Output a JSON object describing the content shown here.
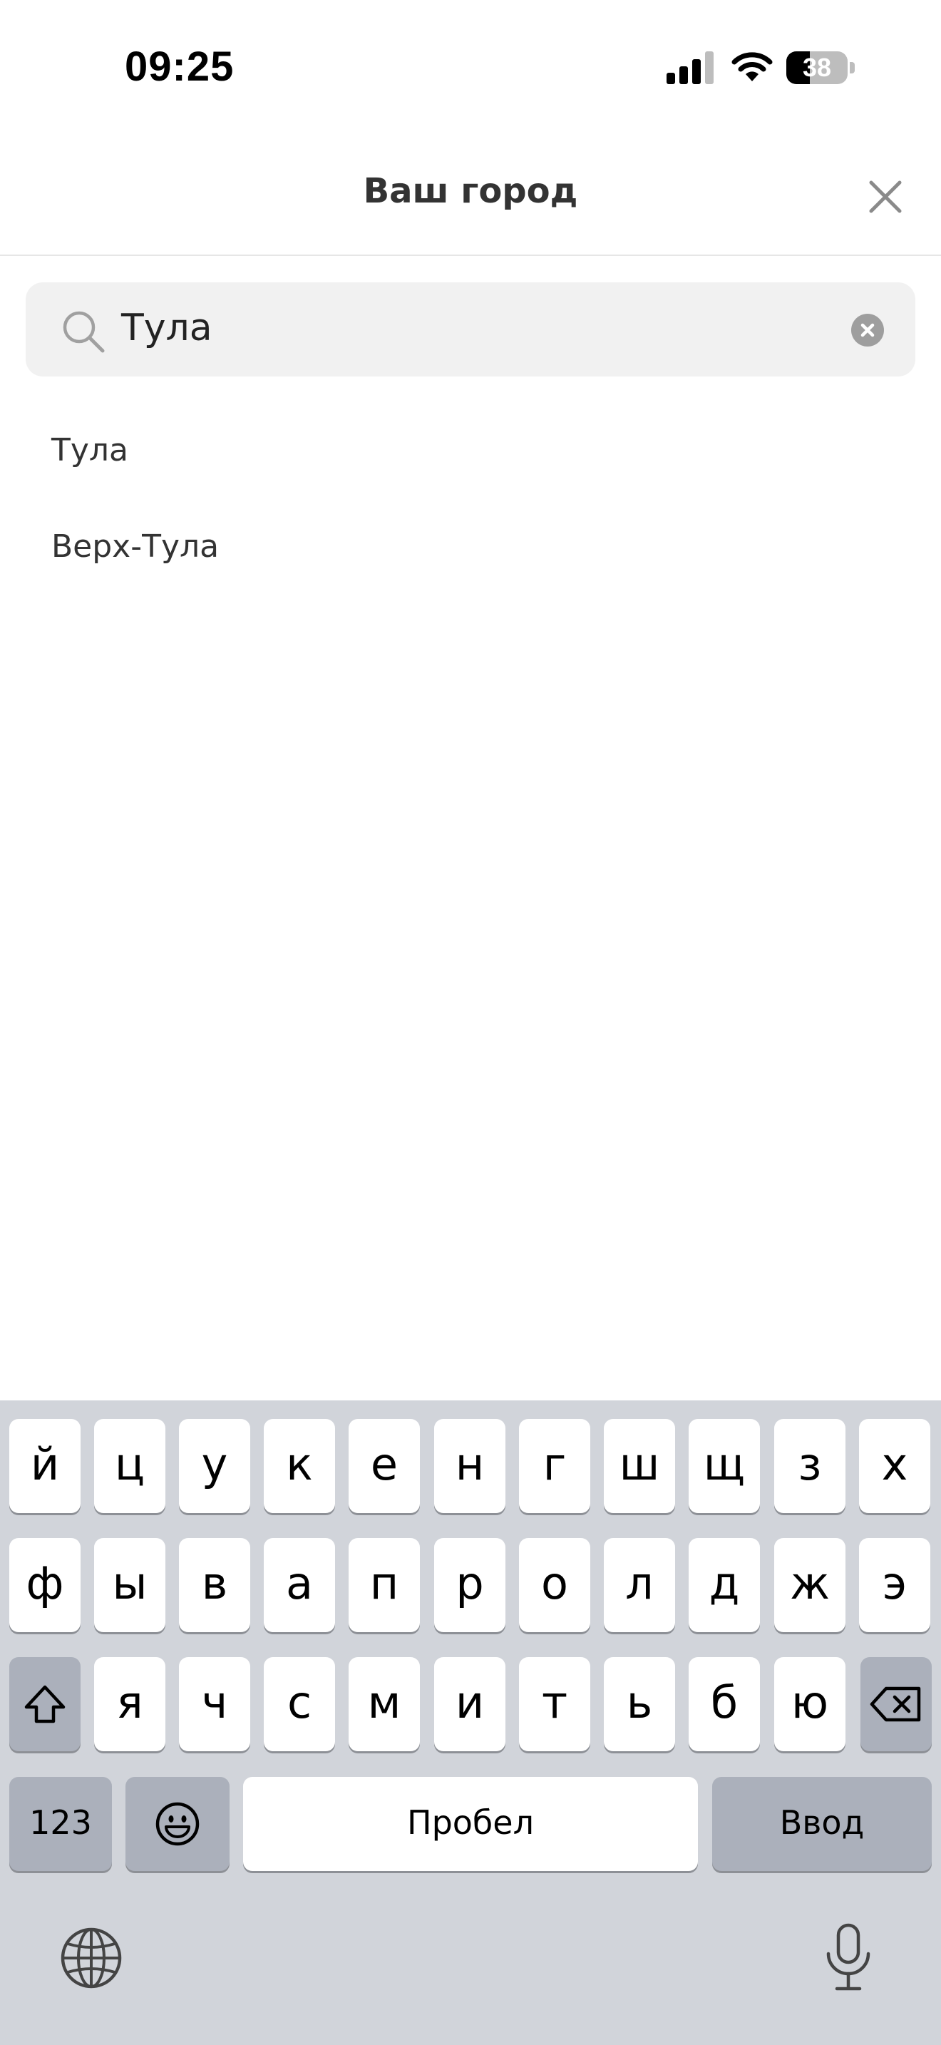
{
  "status_bar": {
    "time": "09:25",
    "battery_level": "38",
    "battery_fraction": 0.38,
    "signal_bars_active": 3,
    "signal_bars_total": 4
  },
  "header": {
    "title": "Ваш город",
    "close_icon": "close-icon"
  },
  "search": {
    "value": "Тула",
    "search_icon": "search-icon",
    "clear_icon": "clear-icon"
  },
  "results": [
    {
      "label": "Тула"
    },
    {
      "label": "Верх-Тула"
    }
  ],
  "keyboard": {
    "row1": [
      "й",
      "ц",
      "у",
      "к",
      "е",
      "н",
      "г",
      "ш",
      "щ",
      "з",
      "х"
    ],
    "row2": [
      "ф",
      "ы",
      "в",
      "а",
      "п",
      "р",
      "о",
      "л",
      "д",
      "ж",
      "э"
    ],
    "row3": [
      "я",
      "ч",
      "с",
      "м",
      "и",
      "т",
      "ь",
      "б",
      "ю"
    ],
    "numbers_label": "123",
    "space_label": "Пробел",
    "return_label": "Ввод",
    "shift_icon": "shift-icon",
    "backspace_icon": "backspace-icon",
    "emoji_icon": "emoji-icon",
    "globe_icon": "globe-icon",
    "mic_icon": "microphone-icon"
  },
  "colors": {
    "keyboard_bg": "#d1d4da",
    "key_bg": "#ffffff",
    "special_key_bg": "#abb0bb",
    "search_bg": "#f1f1f1",
    "text": "#333333"
  }
}
